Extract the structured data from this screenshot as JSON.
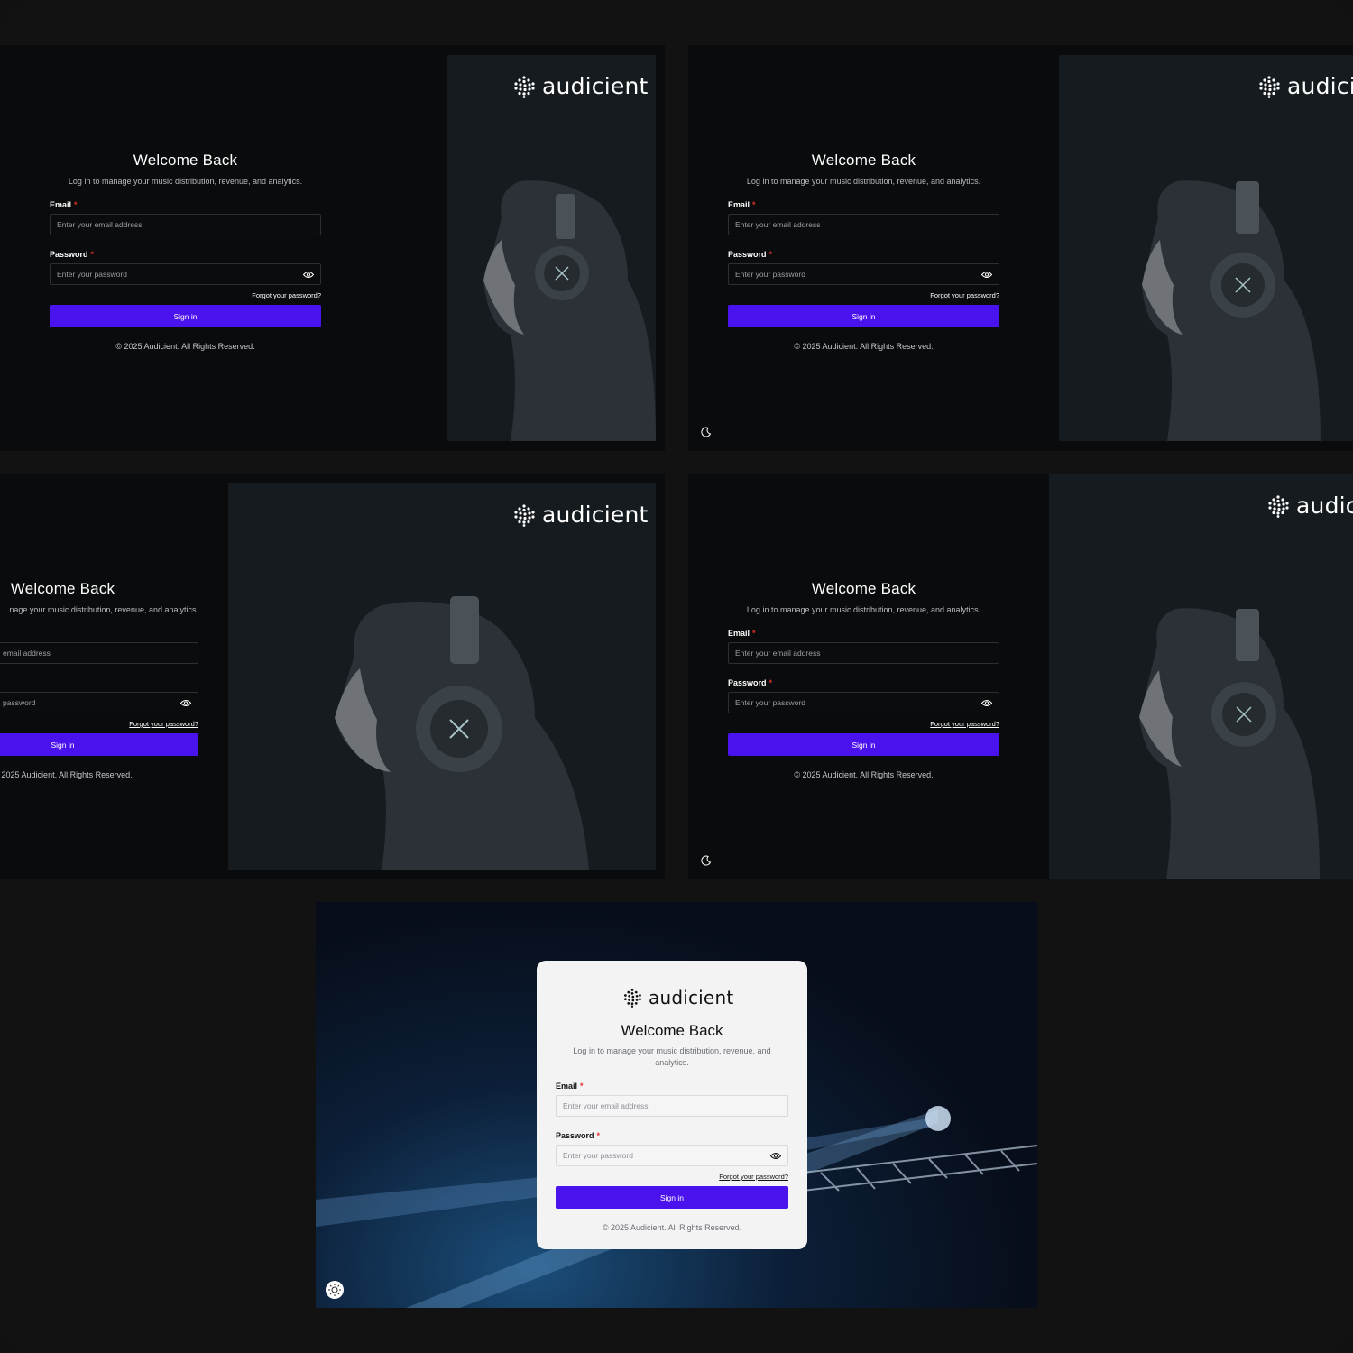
{
  "brand": {
    "name": "audicient"
  },
  "login": {
    "title": "Welcome Back",
    "subtitle": "Log in to manage your music distribution, revenue, and analytics.",
    "email_label": "Email",
    "email_placeholder": "Enter your email address",
    "password_label": "Password",
    "password_placeholder": "Enter your password",
    "required_mark": "*",
    "forgot": "Forgot your password?",
    "signin": "Sign in",
    "copyright": "© 2025 Audicient. All Rights Reserved."
  },
  "cropped": {
    "subtitle": "nage your music distribution, revenue, and analytics.",
    "email_placeholder": "email address",
    "password_placeholder": "password"
  },
  "colors": {
    "accent": "#4a12ec",
    "required": "#e5322d",
    "background": "#0a0b0c",
    "hero": "#151b1f"
  },
  "icons": {
    "logo": "globe-grid-icon",
    "eye": "eye-icon",
    "theme_dark": "moon-icon",
    "theme_light": "sun-icon"
  }
}
